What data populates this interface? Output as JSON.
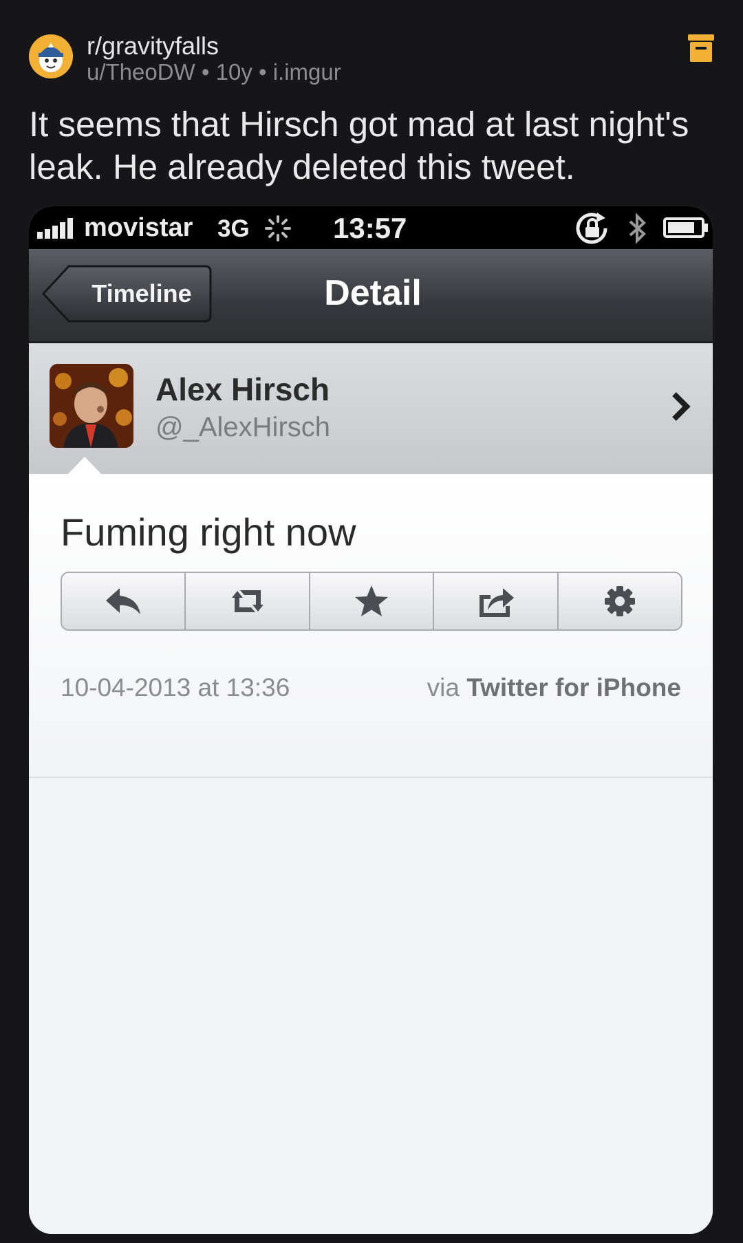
{
  "post": {
    "subreddit": "r/gravityfalls",
    "meta": "u/TheoDW • 10y • i.imgur",
    "title": "It seems that Hirsch got mad at last night's leak. He already deleted this tweet."
  },
  "screenshot": {
    "status_bar": {
      "carrier": "movistar",
      "network": "3G",
      "time": "13:57"
    },
    "nav": {
      "back_label": "Timeline",
      "title": "Detail"
    },
    "profile": {
      "name": "Alex Hirsch",
      "handle": "@_AlexHirsch"
    },
    "tweet": {
      "text": "Fuming right now",
      "date": "10-04-2013 at 13:36",
      "source_prefix": "via",
      "source_app": "Twitter for iPhone"
    },
    "actions": [
      "reply-icon",
      "retweet-icon",
      "favorite-star-icon",
      "share-icon",
      "gear-icon"
    ]
  },
  "colors": {
    "background": "#161618",
    "accent": "#f2b134"
  }
}
